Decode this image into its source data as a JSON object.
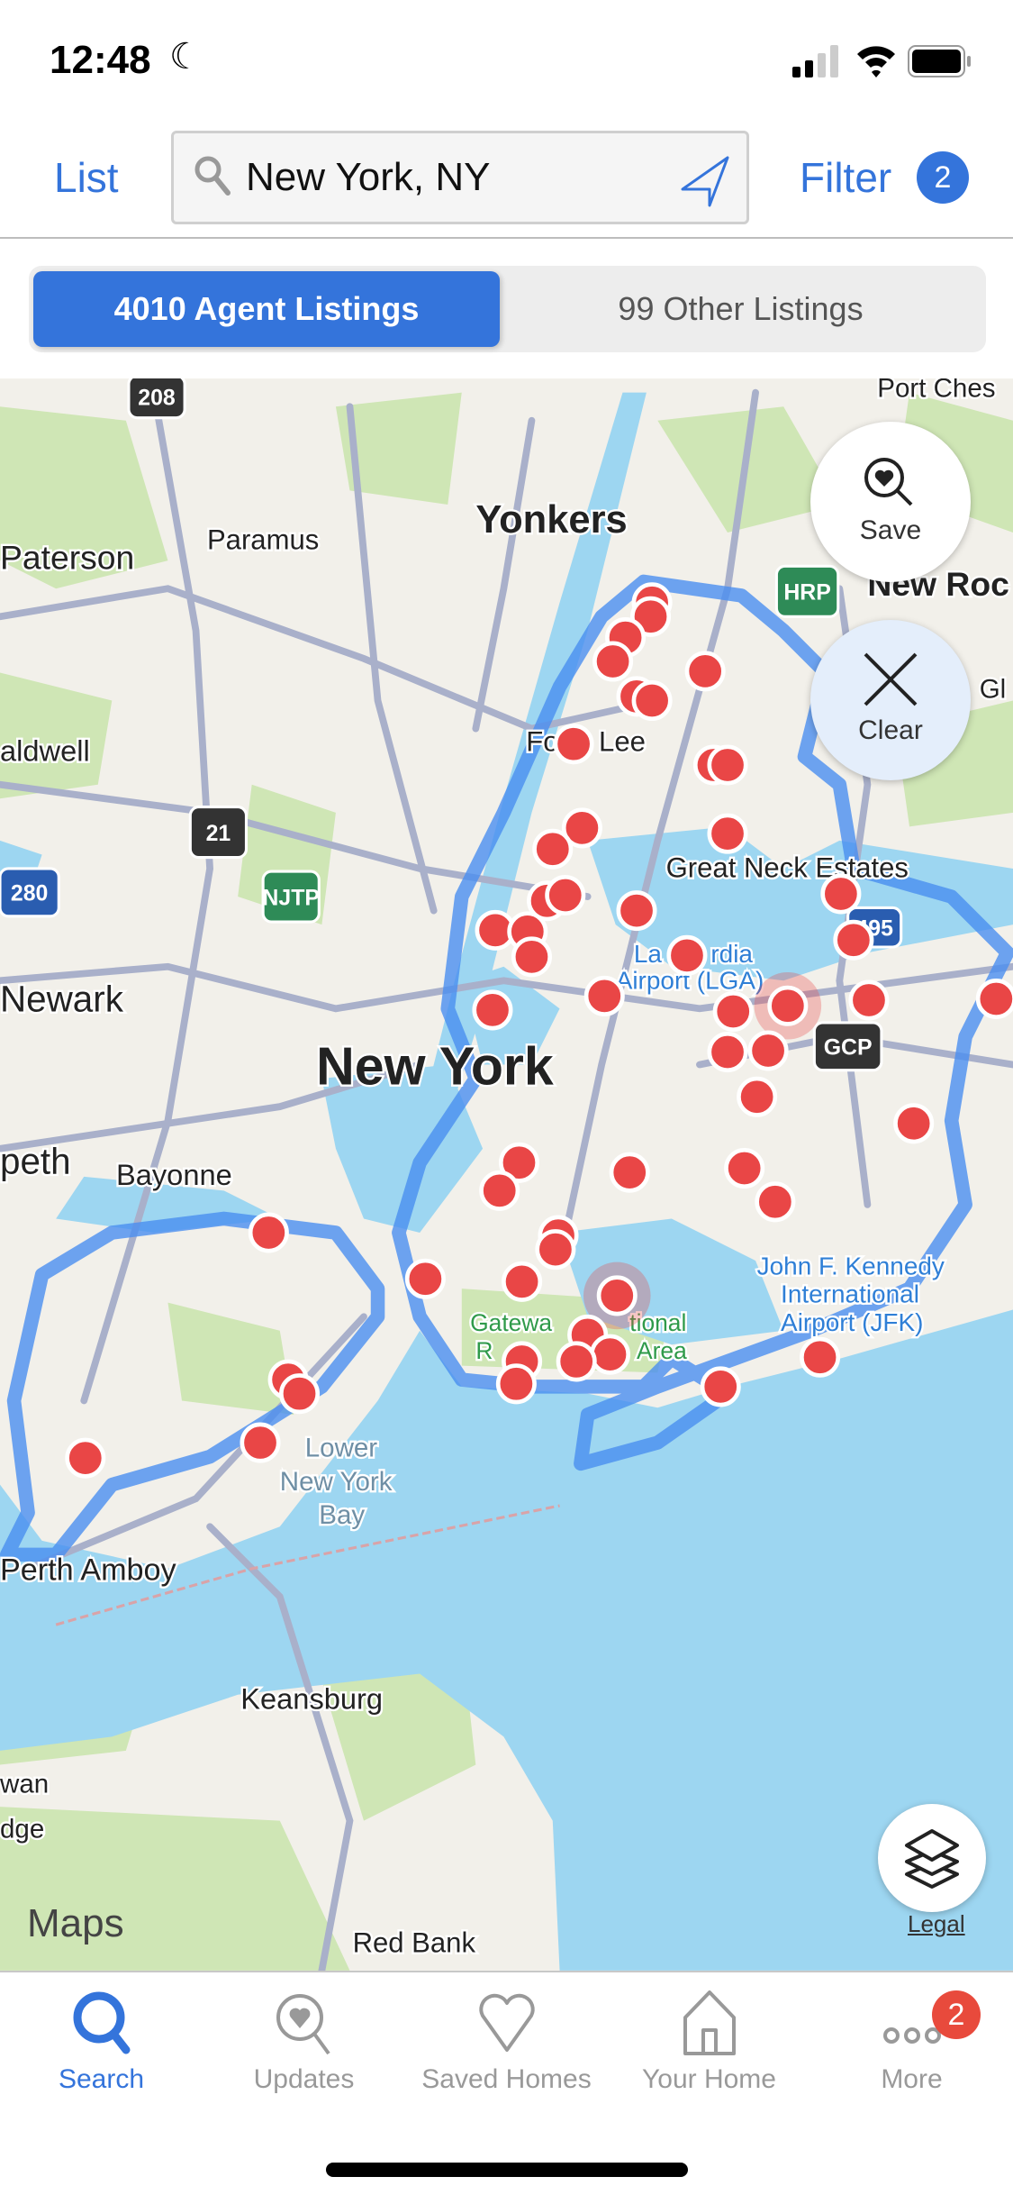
{
  "status_bar": {
    "time": "12:48",
    "moon_icon": "moon-icon",
    "signal_icon": "cellular-signal-icon",
    "wifi_icon": "wifi-icon",
    "battery_icon": "battery-icon"
  },
  "header": {
    "list_label": "List",
    "search_value": "New York, NY",
    "filter_label": "Filter",
    "filter_count": "2"
  },
  "segments": {
    "agent": "4010 Agent Listings",
    "other": "99 Other Listings",
    "active": "agent"
  },
  "map": {
    "labels": [
      "Port Ches",
      "Yonkers",
      "Paramus",
      "Paterson",
      "New Roc",
      "Gl",
      "aldwell",
      "Fo",
      "Lee",
      "Great Neck Estates",
      "La",
      "rdia",
      "Airport (LGA)",
      "Newark",
      "New York",
      "peth",
      "Bayonne",
      "John F. Kennedy",
      "International",
      "Airport (JFK)",
      "Gatewa",
      "tional",
      "R",
      "Area",
      "Lower",
      "New York",
      "Bay",
      "Perth Amboy",
      "Keansburg",
      "wan",
      "dge",
      "Red Bank"
    ],
    "shields": [
      "208",
      "21",
      "280",
      "495",
      "HRP",
      "NJTP",
      "GCP"
    ],
    "attribution": "Maps",
    "save_label": "Save",
    "clear_label": "Clear",
    "legal_label": "Legal",
    "colors": {
      "land": "#f2f0ea",
      "water": "#9dd6f1",
      "park": "#cfe6b5",
      "road": "#a9b0ca",
      "boundary": "#4a8ff0",
      "pin": "#e94646"
    }
  },
  "tabs": [
    {
      "label": "Search",
      "active": true
    },
    {
      "label": "Updates"
    },
    {
      "label": "Saved Homes"
    },
    {
      "label": "Your Home"
    },
    {
      "label": "More",
      "badge": "2"
    }
  ],
  "accent": "#3474db"
}
